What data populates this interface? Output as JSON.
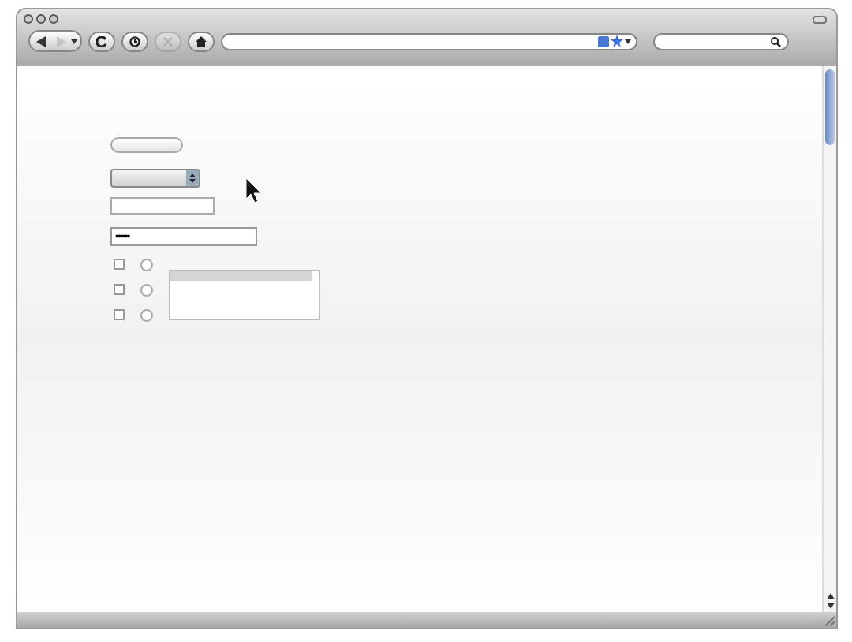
{
  "toolbar": {
    "back_disabled": false,
    "forward_disabled": true,
    "stop_disabled": true
  },
  "form": {
    "password": {
      "value": "••••••"
    },
    "checkboxes": [
      {
        "checked": false
      },
      {
        "checked": false
      },
      {
        "checked": false
      }
    ],
    "radios": [
      {
        "selected": false
      },
      {
        "selected": false
      },
      {
        "selected": false
      }
    ],
    "listbox": {
      "rows": [
        {
          "selected": true
        }
      ]
    }
  }
}
